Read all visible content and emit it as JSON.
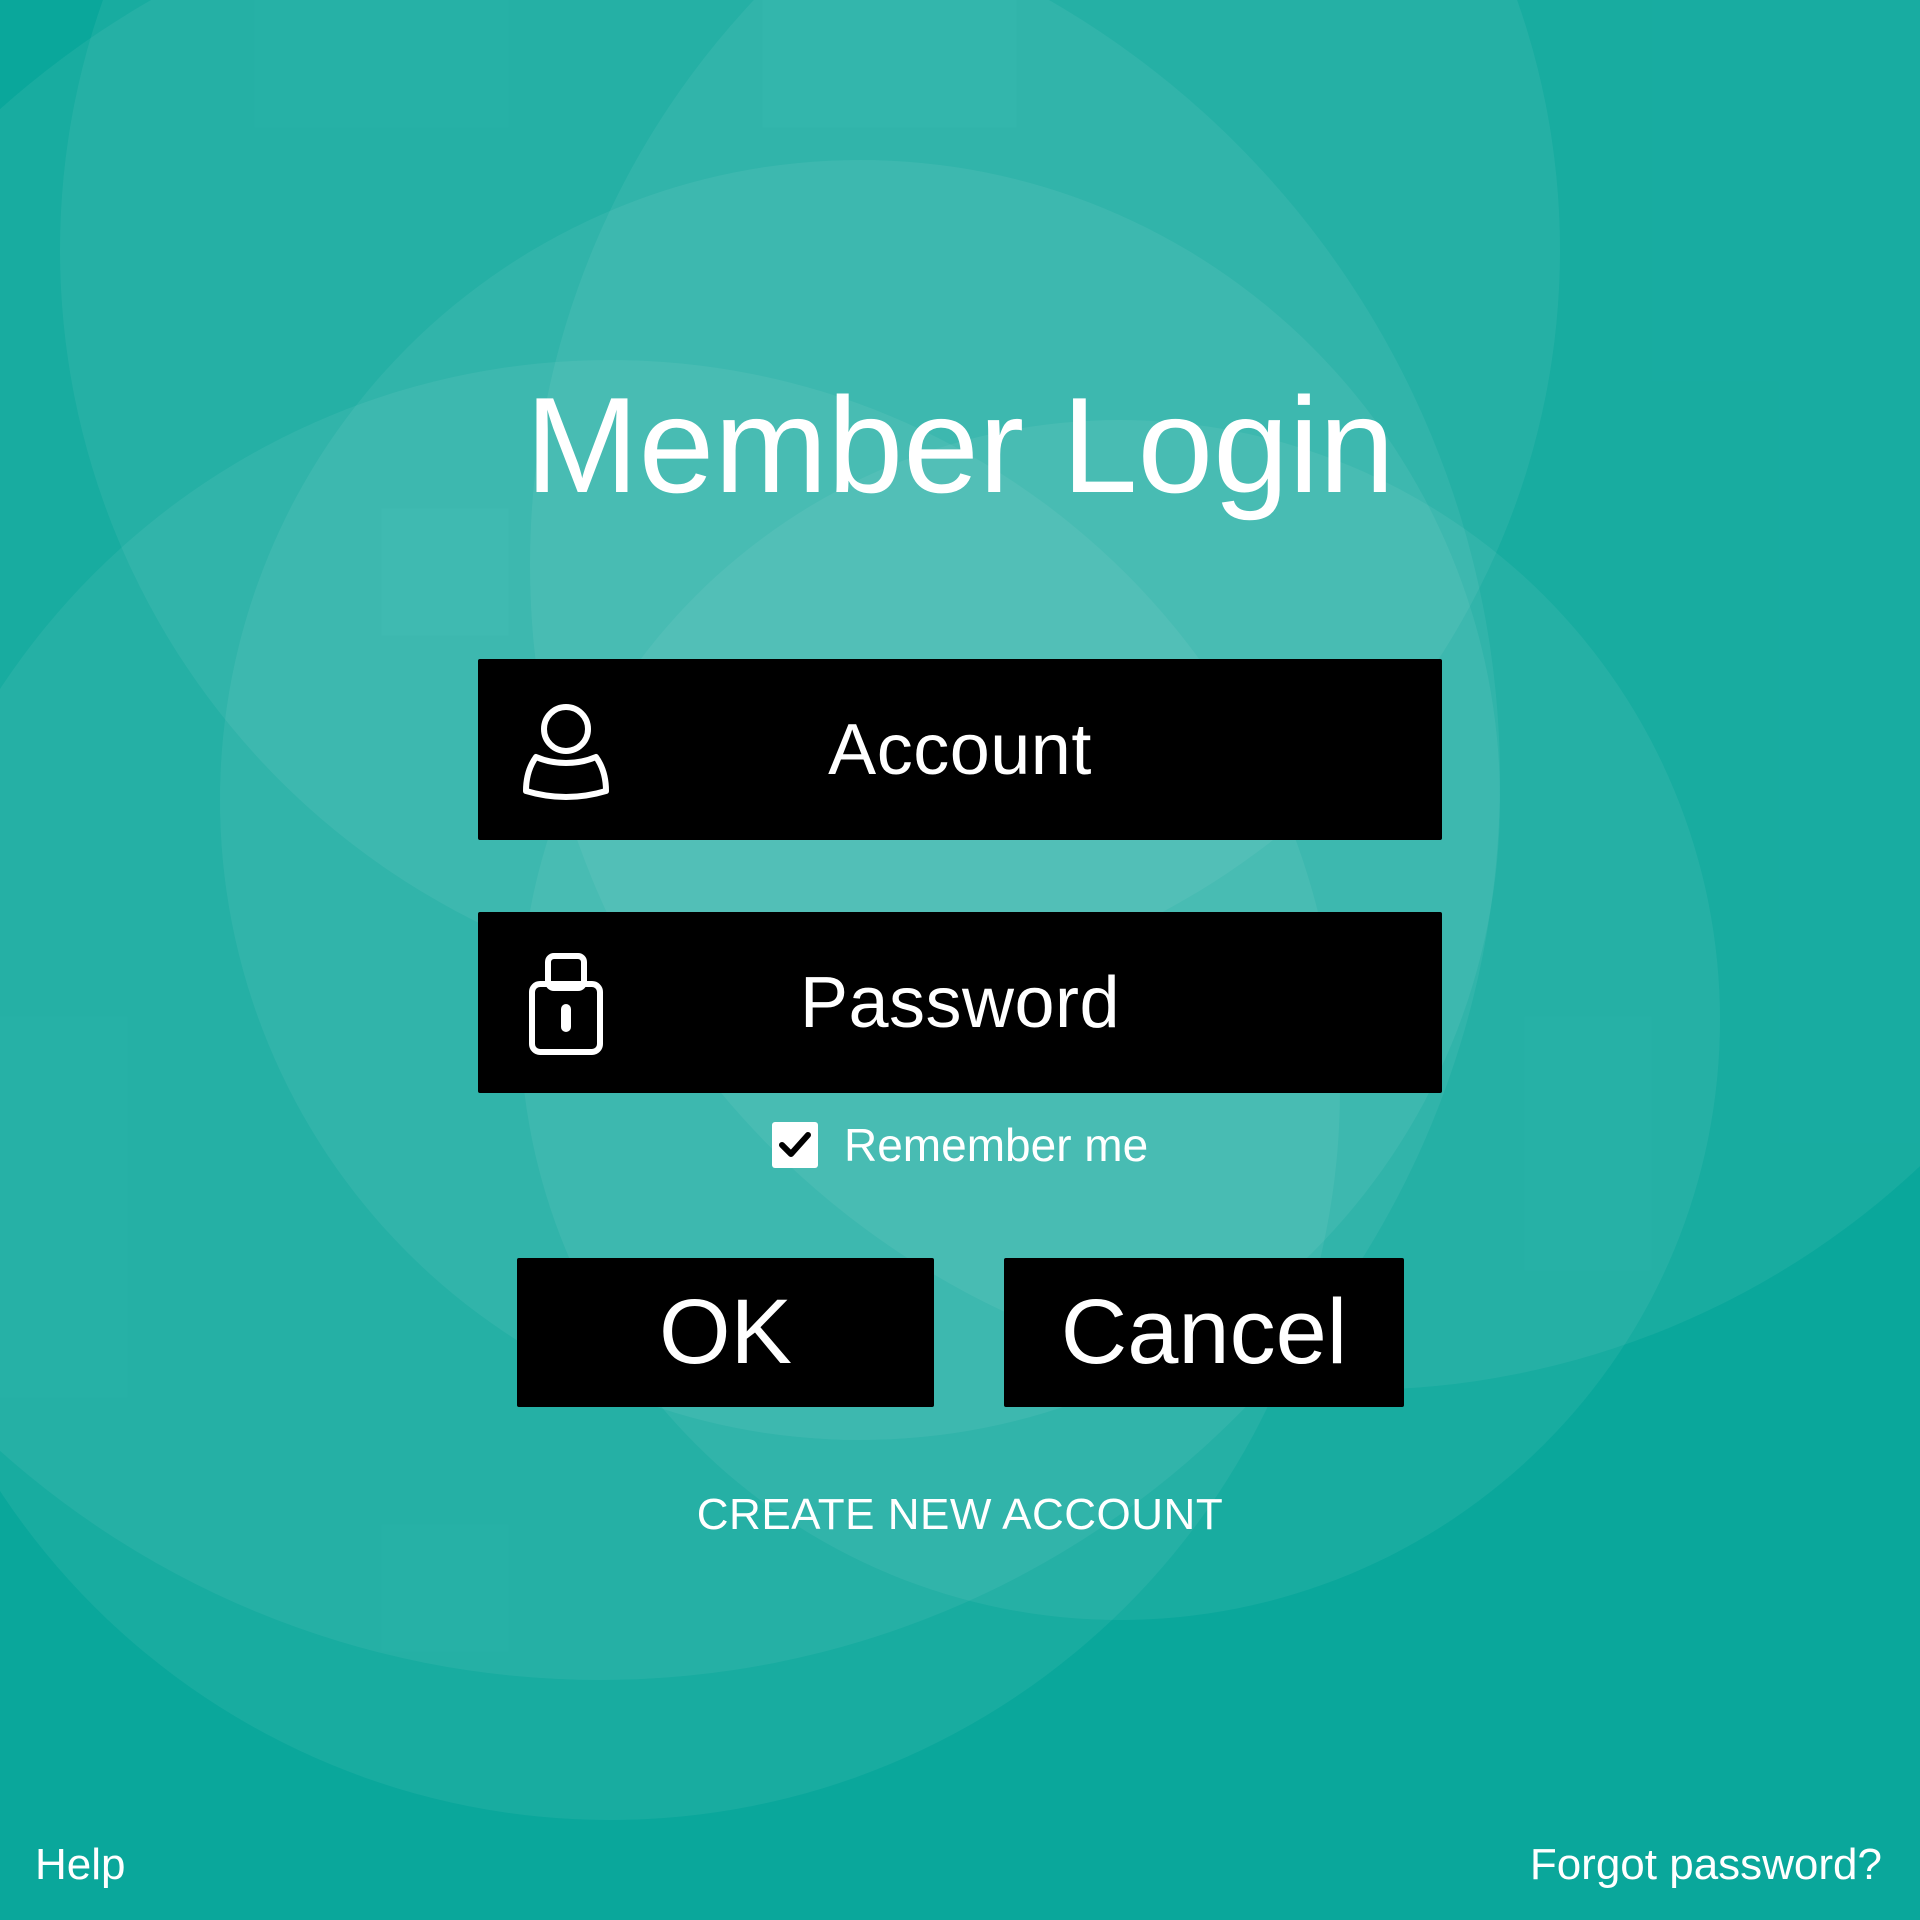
{
  "login": {
    "title": "Member Login",
    "account_placeholder": "Account",
    "password_placeholder": "Password",
    "remember_label": "Remember me",
    "remember_checked": true,
    "ok_label": "OK",
    "cancel_label": "Cancel",
    "create_account_label": "CREATE NEW ACCOUNT"
  },
  "footer": {
    "help_label": "Help",
    "forgot_label": "Forgot password?"
  },
  "icons": {
    "account": "user-icon",
    "password": "lock-icon",
    "remember": "checkmark-icon"
  },
  "colors": {
    "background": "#0aa79b",
    "field_background": "#000000",
    "text": "#ffffff"
  }
}
